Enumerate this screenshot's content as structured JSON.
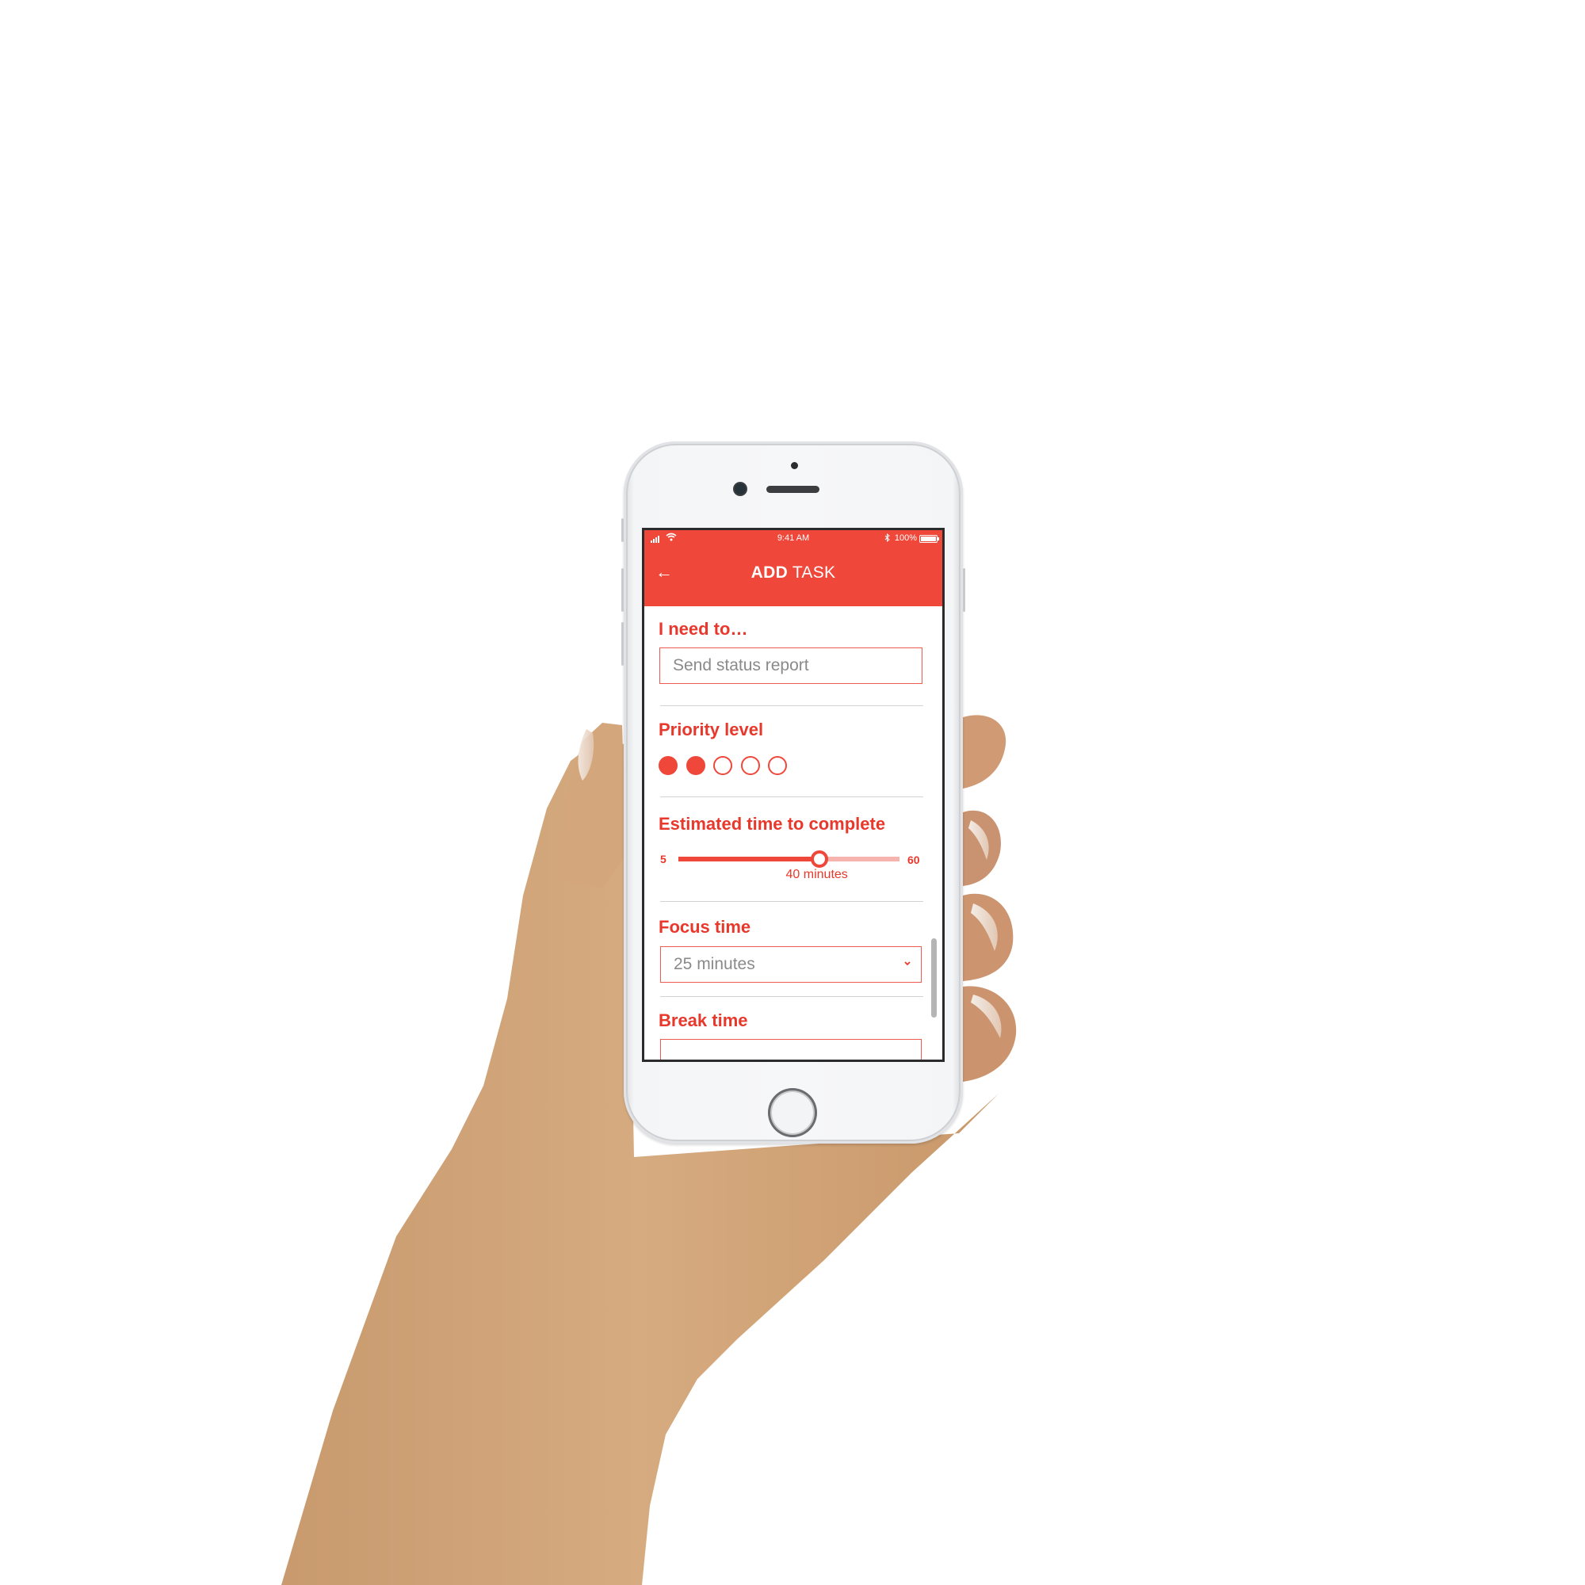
{
  "scene": {
    "description": "Hand holding a white smartphone showing a task-creation app",
    "colors": {
      "accent": "#ef473a",
      "accent_light": "#f7b3ad",
      "label_text": "#e8382c",
      "input_text": "#8a8a8a",
      "divider": "#d3d3d3",
      "skin": "#d2a67b"
    }
  },
  "status_bar": {
    "time": "9:41 AM",
    "battery": "100%",
    "signal_icon": "cellular-signal-icon",
    "wifi_icon": "wifi-icon",
    "bluetooth_icon": "bluetooth-icon",
    "battery_icon": "battery-icon"
  },
  "header": {
    "back_icon": "arrow-left-icon",
    "back_glyph": "←",
    "title_bold": "ADD",
    "title_regular": " TASK"
  },
  "form": {
    "task": {
      "label": "I need to…",
      "value": "Send status report"
    },
    "priority": {
      "label": "Priority level",
      "level": 2,
      "max": 5
    },
    "estimated_time": {
      "label": "Estimated time to complete",
      "min_label": "5",
      "max_label": "60",
      "min": 5,
      "max": 60,
      "value": 40,
      "value_label": "40 minutes"
    },
    "focus_time": {
      "label": "Focus time",
      "value": "25 minutes",
      "chevron_glyph": "⌄"
    },
    "break_time": {
      "label": "Break time",
      "value": ""
    }
  }
}
